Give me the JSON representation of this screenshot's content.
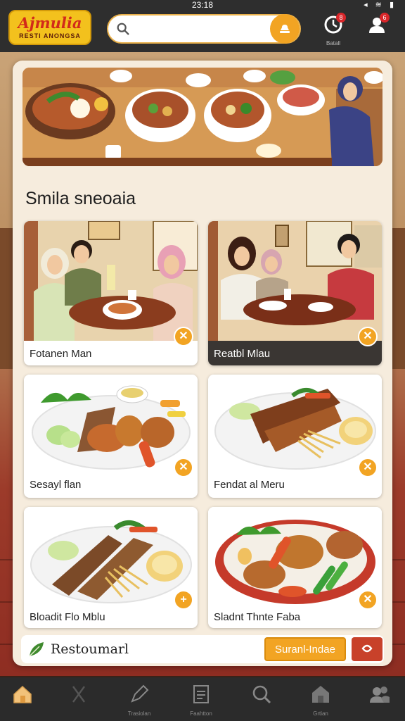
{
  "status": {
    "time": "23:18",
    "icons": "◂ ≋ ▮"
  },
  "app": {
    "logo_title": "Ajmulia",
    "logo_subtitle": "RESTI ANONGSA",
    "colors": {
      "accent": "#f2a423",
      "bar": "#2e2e2e",
      "badge": "#d9262a",
      "logo": "#f3c11d"
    }
  },
  "search": {
    "placeholder": "",
    "value": "",
    "button_icon": "bell-icon"
  },
  "top_actions": [
    {
      "name": "timer-icon",
      "label": "Batall",
      "badge": "8"
    },
    {
      "name": "profile-icon",
      "label": "",
      "badge": "6"
    }
  ],
  "section": {
    "title": "Smila sneoaia"
  },
  "cards": [
    {
      "caption": "Fotanen Man",
      "image": "family-dining-scene",
      "fav_icon": "✕"
    },
    {
      "caption": "Reatbl Mlau",
      "image": "couple-dining-scene",
      "fav_icon": "✕"
    },
    {
      "caption": "Sesayl flan",
      "image": "grilled-skewers-plate",
      "fav_icon": "✕"
    },
    {
      "caption": "Fendat al Meru",
      "image": "fried-fish-plate",
      "fav_icon": "✕"
    },
    {
      "caption": "Bloadit Flo Mblu",
      "image": "grilled-meat-plate",
      "fav_icon": "+"
    },
    {
      "caption": "Sladnt Thnte Faba",
      "image": "chicken-bowl",
      "fav_icon": "✕"
    }
  ],
  "strip": {
    "label": "Restoumarl",
    "button": "Suranl-Indae"
  },
  "bottom_nav": [
    {
      "name": "home-icon",
      "label": ""
    },
    {
      "name": "utensils-icon",
      "label": ""
    },
    {
      "name": "pen-icon",
      "label": "Trasiolan"
    },
    {
      "name": "list-icon",
      "label": "Faahtton"
    },
    {
      "name": "search-icon",
      "label": ""
    },
    {
      "name": "shop-icon",
      "label": "Grtian"
    },
    {
      "name": "users-icon",
      "label": ""
    }
  ]
}
